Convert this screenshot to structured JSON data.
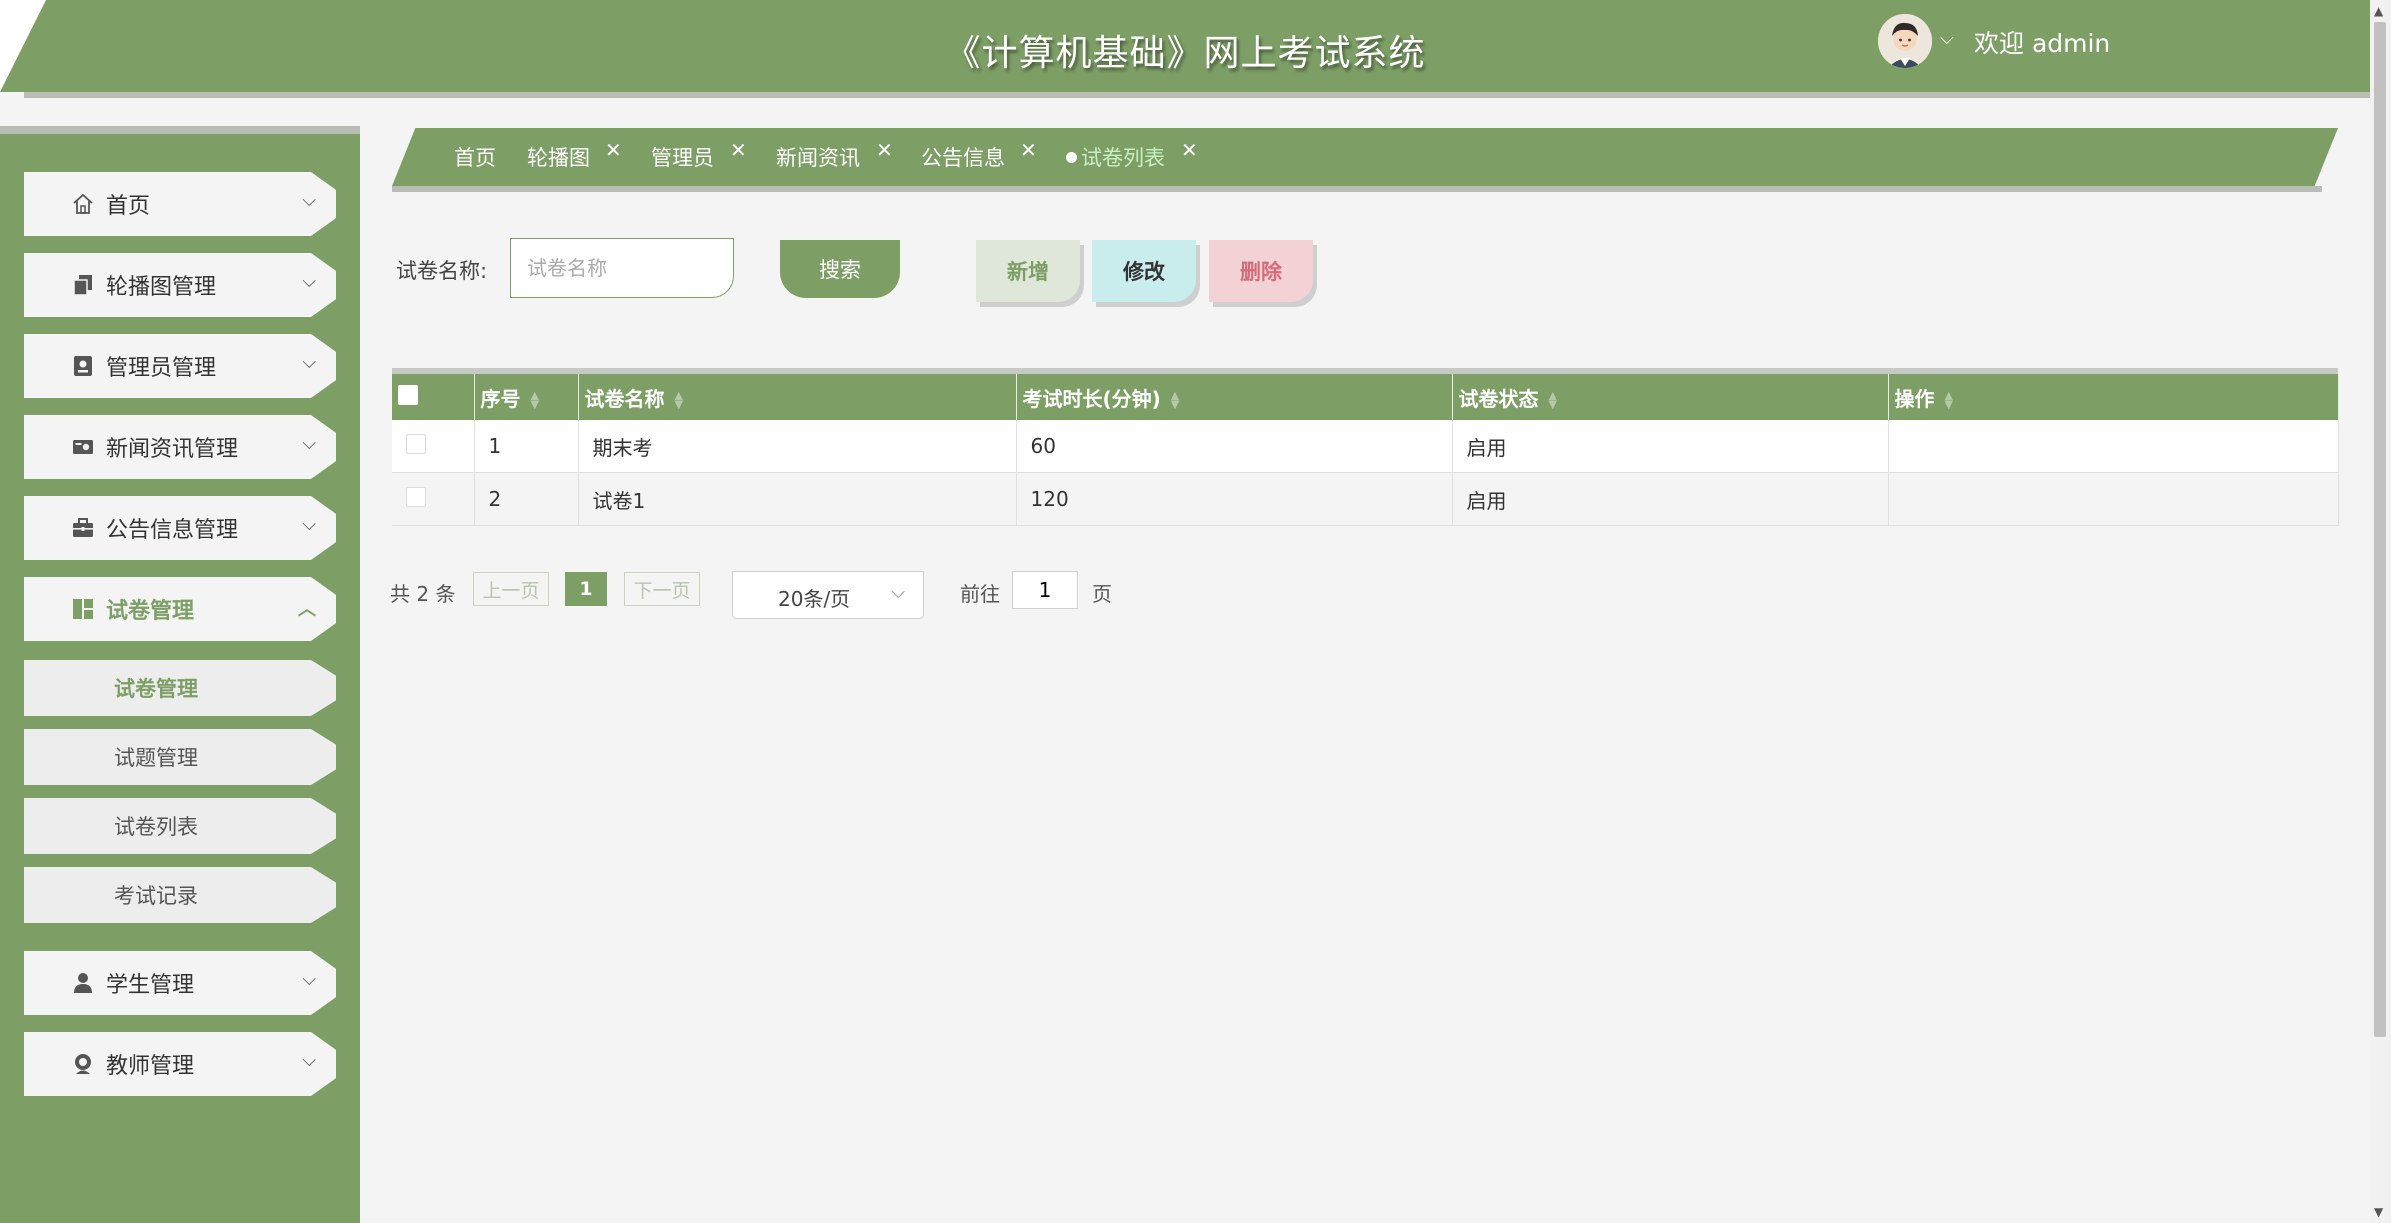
{
  "header": {
    "title": "《计算机基础》网上考试系统",
    "welcome": "欢迎 admin",
    "bg_color": "#7d9f66"
  },
  "sidebar": {
    "menu": [
      {
        "label": "首页",
        "icon": "home-icon"
      },
      {
        "label": "轮播图管理",
        "icon": "carousel-icon"
      },
      {
        "label": "管理员管理",
        "icon": "admin-icon"
      },
      {
        "label": "新闻资讯管理",
        "icon": "news-icon"
      },
      {
        "label": "公告信息管理",
        "icon": "briefcase-icon"
      },
      {
        "label": "试卷管理",
        "icon": "layout-icon",
        "expanded": true
      },
      {
        "label": "学生管理",
        "icon": "user-icon"
      },
      {
        "label": "教师管理",
        "icon": "teacher-icon"
      }
    ],
    "submenu": [
      {
        "label": "试卷管理",
        "active": true
      },
      {
        "label": "试题管理"
      },
      {
        "label": "试卷列表"
      },
      {
        "label": "考试记录"
      }
    ]
  },
  "tabs": [
    {
      "label": "首页"
    },
    {
      "label": "轮播图"
    },
    {
      "label": "管理员"
    },
    {
      "label": "新闻资讯"
    },
    {
      "label": "公告信息"
    },
    {
      "label": "试卷列表",
      "active": true
    }
  ],
  "search": {
    "label": "试卷名称:",
    "placeholder": "试卷名称",
    "search_button": "搜索",
    "add_button": "新增",
    "edit_button": "修改",
    "delete_button": "删除"
  },
  "table": {
    "columns": [
      "序号",
      "试卷名称",
      "考试时长(分钟)",
      "试卷状态",
      "操作"
    ],
    "rows": [
      {
        "index": "1",
        "name": "期末考",
        "duration": "60",
        "status": "启用",
        "action": ""
      },
      {
        "index": "2",
        "name": "试卷1",
        "duration": "120",
        "status": "启用",
        "action": ""
      }
    ]
  },
  "pagination": {
    "total": "共 2 条",
    "prev": "上一页",
    "current": "1",
    "next": "下一页",
    "page_size": "20条/页",
    "goto_label": "前往",
    "goto_value": "1",
    "page_suffix": "页"
  }
}
